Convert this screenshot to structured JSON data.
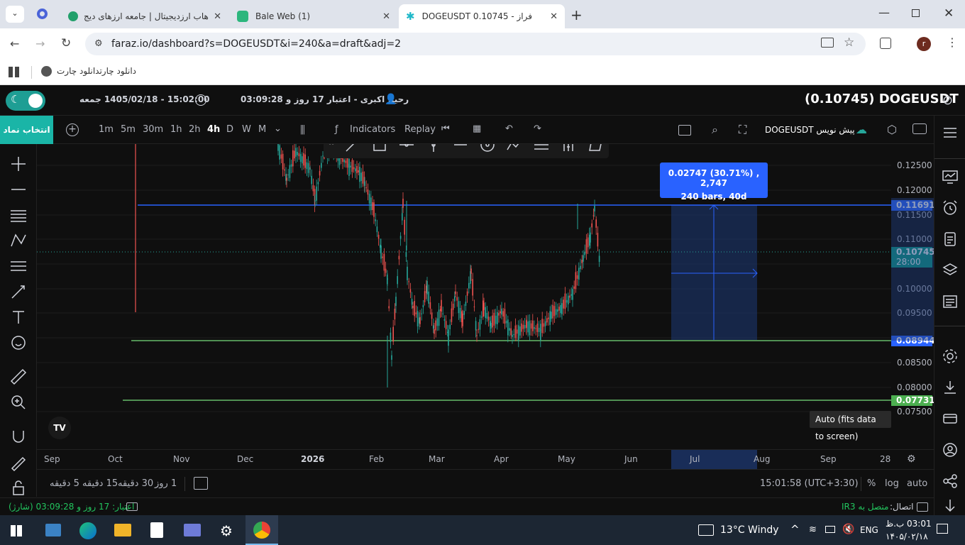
{
  "browser": {
    "tabs": [
      {
        "label": "هاب ارزدیجیتال | جامعه ارزهای دیج"
      },
      {
        "label": "Bale Web (1)"
      },
      {
        "label": "DOGEUSDT 0.10745 - فراز"
      }
    ],
    "new_tab": "+",
    "url": "faraz.io/dashboard?s=DOGEUSDT&i=240&a=draft&adj=2",
    "profile_initial": "r",
    "bookmark": "دانلود چارتدانلود چارت",
    "window_controls": [
      "minimize-icon",
      "restore-icon",
      "close-icon"
    ]
  },
  "header": {
    "symbol_title": "(0.10745)  DOGEUSDT",
    "user": "رحیم اکبری - اعتبار 17 روز و 03:09:28",
    "datetime": "15:02:00 - 1405/02/18 جمعه"
  },
  "toolbar": {
    "select_symbol": "انتخاب نماد",
    "intervals": [
      "1m",
      "5m",
      "30m",
      "1h",
      "2h",
      "4h",
      "D",
      "W",
      "M"
    ],
    "active_interval": "4h",
    "indicators": "Indicators",
    "replay": "Replay",
    "draft_label": "DOGEUSDT پیش نویس"
  },
  "chart": {
    "accent": "#2962ff",
    "up_color": "#26a69a",
    "down_color": "#ef5350",
    "measure": {
      "line1": "0.02747 (30.71%) , 2,747",
      "line2": "240 bars, 40d"
    },
    "tooltip": "Auto (fits data to screen)",
    "price_ticks": [
      "0.12500",
      "0.12000",
      "0.11500",
      "0.11000",
      "0.10000",
      "0.09500",
      "0.08500",
      "0.08000",
      "0.07500"
    ],
    "price_labels": [
      {
        "value": "0.11691",
        "color": "#2962ff"
      },
      {
        "value": "0.10745",
        "sub": "28:00",
        "color": "#089981"
      },
      {
        "value": "0.08944",
        "color": "#2962ff"
      },
      {
        "value": "0.07731",
        "color": "#4caf50"
      }
    ],
    "time_ticks": [
      "Sep",
      "Oct",
      "Nov",
      "Dec",
      "2026",
      "Feb",
      "Mar",
      "Apr",
      "May",
      "Jun",
      "Jul",
      "Aug",
      "Sep",
      "28"
    ],
    "scale_buttons": [
      "A",
      "L"
    ]
  },
  "bottom": {
    "ranges": [
      "5 دقیقه",
      "15 دقیقه",
      "30 دقیقه",
      "1 روز"
    ],
    "clock": "15:01:58 (UTC+3:30)",
    "percent": "%",
    "log": "log",
    "auto": "auto"
  },
  "status": {
    "credit": "اعتبار: 17 روز و 03:09:28 (شارژ)",
    "connection_label": "اتصال:",
    "connection_value": "متصل به IR3"
  },
  "taskbar": {
    "weather": "13°C  Windy",
    "lang": "ENG",
    "time": "03:01 ب.ظ",
    "date": "۱۴۰۵/۰۲/۱۸"
  }
}
